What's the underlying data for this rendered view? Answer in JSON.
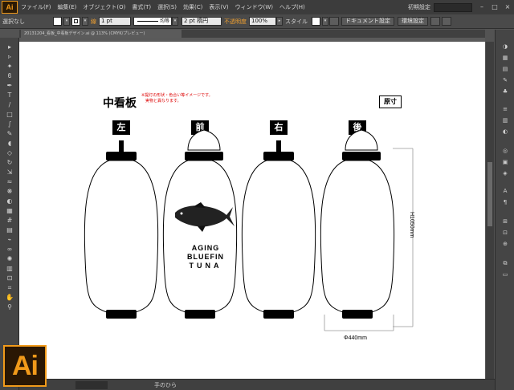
{
  "app": {
    "logo": "Ai",
    "workspace": "初期設定"
  },
  "menu": [
    "ファイル(F)",
    "編集(E)",
    "オブジェクト(O)",
    "書式(T)",
    "選択(S)",
    "効果(C)",
    "表示(V)",
    "ウィンドウ(W)",
    "ヘルプ(H)"
  ],
  "control": {
    "selection_status": "選択なし",
    "stroke_label": "線",
    "stroke_weight": "1 pt",
    "stroke_profile": "均等",
    "brush": "2 pt 楕円",
    "opacity_label": "不透明度",
    "opacity_value": "100%",
    "style_label": "スタイル",
    "doc_setup": "ドキュメント設定",
    "prefs": "環境設定"
  },
  "document_tab": "20131204_看板_中看板デザイン.ai @ 113% (CMYK/プレビュー)",
  "status": {
    "tool": "手のひら"
  },
  "artboard": {
    "title": "中看板",
    "note": "※提灯の形状・色合い等イメージです。\n　実物と異なります。",
    "sample_label": "原寸",
    "sides": [
      "左",
      "前",
      "右",
      "後"
    ],
    "lantern_text": [
      "AGING",
      "BLUEFIN",
      "TUNA"
    ],
    "height_dim": "H1050mm",
    "width_dim": "Φ440mm"
  },
  "colors": {
    "accent": "#f19a1a",
    "ui_dark": "#535353",
    "warning": "#dd0000"
  }
}
